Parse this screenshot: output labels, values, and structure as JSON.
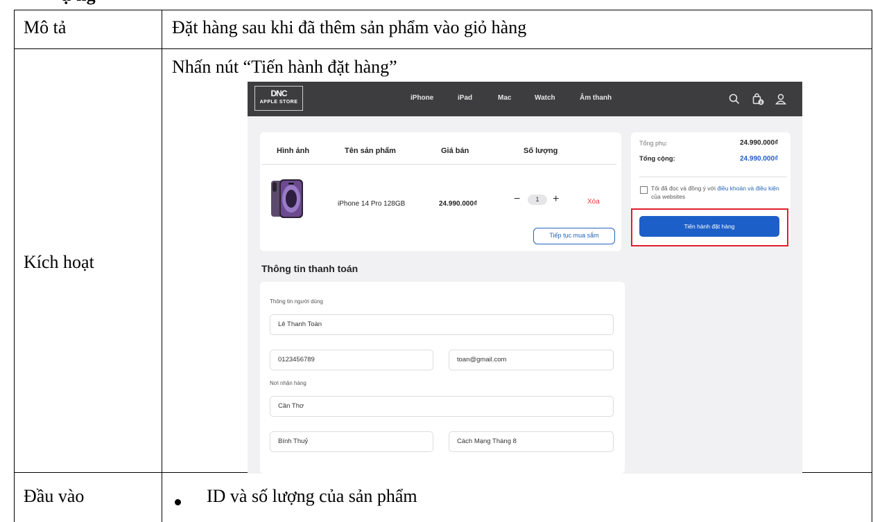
{
  "document": {
    "cut_heading": "ự     ng",
    "rows": [
      {
        "label": "Mô tả",
        "content": "Đặt hàng sau khi đã thêm sản phẩm vào giỏ hàng"
      },
      {
        "label": "Kích hoạt",
        "content": "Nhấn nút “Tiến hành đặt hàng”"
      },
      {
        "label": "Đầu vào",
        "bullet": "ID và số lượng của sản phẩm"
      }
    ]
  },
  "screenshot": {
    "logo": {
      "mark": "DNC",
      "text": "APPLE STORE"
    },
    "nav": [
      "iPhone",
      "iPad",
      "Mac",
      "Watch",
      "Âm thanh"
    ],
    "nav_icons": [
      "search-icon",
      "bag-icon",
      "user-icon"
    ],
    "cart_badge": "0",
    "cart": {
      "headers": [
        "Hình ảnh",
        "Tên sản phẩm",
        "Giá bán",
        "Số lượng"
      ],
      "item": {
        "name": "iPhone 14 Pro 128GB",
        "price": "24.990.000₫",
        "quantity": "1",
        "minus": "−",
        "plus": "+",
        "delete": "Xóa"
      },
      "continue_button": "Tiếp tục mua sắm"
    },
    "summary": {
      "subtotal_label": "Tổng phụ:",
      "subtotal_value": "24.990.000₫",
      "total_label": "Tổng cộng:",
      "total_value": "24.990.000₫",
      "terms_prefix": "Tôi đã đọc và đồng ý với ",
      "terms_link": "điều khoản và điều kiện",
      "terms_suffix": " của websites",
      "checkout_button": "Tiến hành đặt hàng"
    },
    "payment": {
      "title": "Thông tin thanh toán",
      "user_info_label": "Thông tin người dùng",
      "full_name": "Lê Thanh Toàn",
      "phone": "0123456789",
      "email": "toan@gmail.com",
      "address_label": "Nơi nhận hàng",
      "city": "Cần Thơ",
      "district": "Bình Thuỷ",
      "street": "Cách Mạng Tháng 8"
    },
    "colors": {
      "navbar": "#3d3d3f",
      "accent_blue": "#1d5fc8",
      "highlight_red": "#e11d2a",
      "delete_red": "#e53935"
    }
  }
}
